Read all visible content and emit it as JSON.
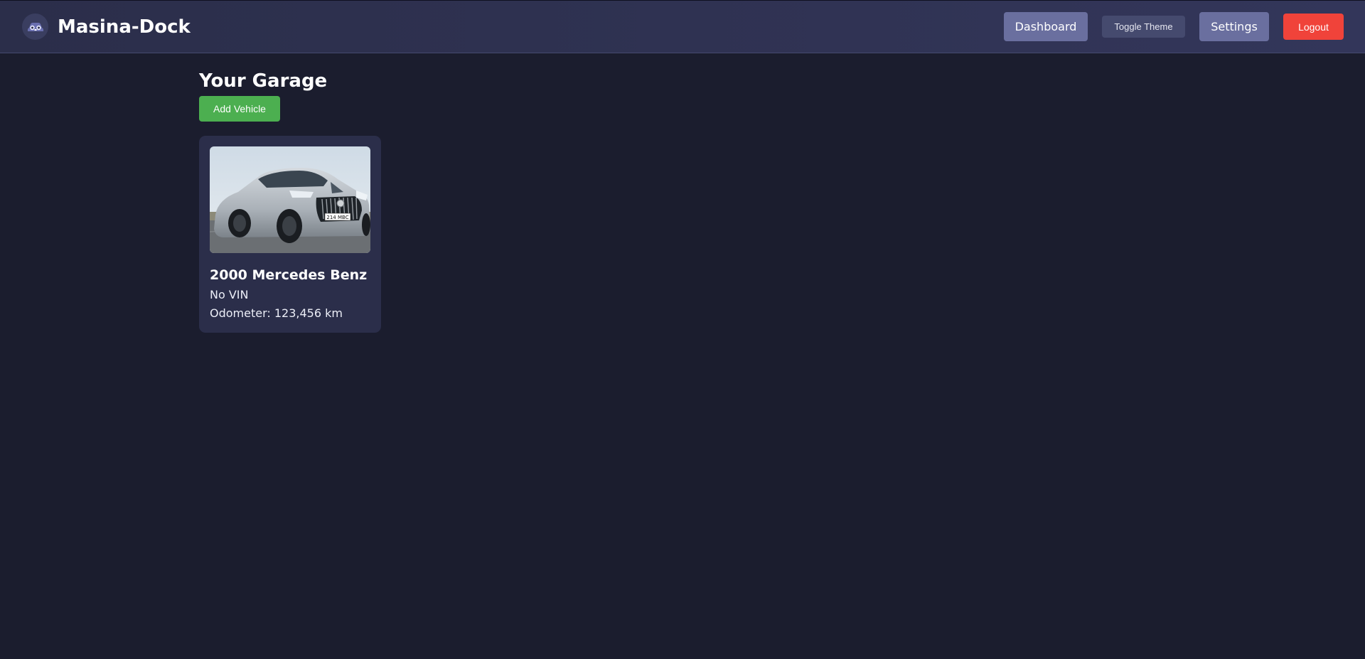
{
  "app": {
    "name": "Masina-Dock",
    "logo_icon": "car-face-icon"
  },
  "nav": {
    "dashboard_label": "Dashboard",
    "toggle_theme_label": "Toggle Theme",
    "settings_label": "Settings",
    "logout_label": "Logout"
  },
  "colors": {
    "background": "#1b1d2e",
    "navbar": "#2b2e4a",
    "primary_button": "#6a6f9f",
    "add_button": "#4caf50",
    "logout_button": "#f0433a",
    "card": "#2b2e4a"
  },
  "garage": {
    "title": "Your Garage",
    "add_vehicle_label": "Add Vehicle",
    "vehicles": [
      {
        "title": "2000 Mercedes Benz",
        "vin": "No VIN",
        "odometer": "Odometer: 123,456 km",
        "photo_plate": "214 MBC",
        "photo_icon": "silver-sedan-photo"
      }
    ]
  }
}
